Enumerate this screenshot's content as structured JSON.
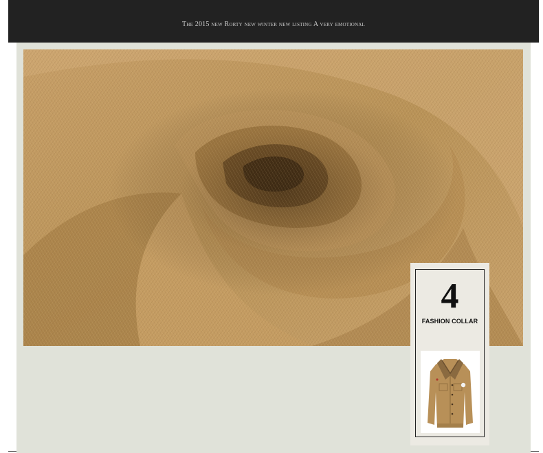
{
  "header": {
    "tagline": "The 2015 new Rorty new winter new listing  A very emotional"
  },
  "feature_card": {
    "number": "4",
    "label": "FASHION COLLAR"
  },
  "colors": {
    "header_bg": "#222222",
    "panel_bg": "#e0e2d9",
    "fabric": "#b8935c"
  },
  "images": {
    "hero": "khaki-twill-fabric-swirl-photo",
    "product": "khaki-jacket-with-fleece-collar-photo"
  }
}
